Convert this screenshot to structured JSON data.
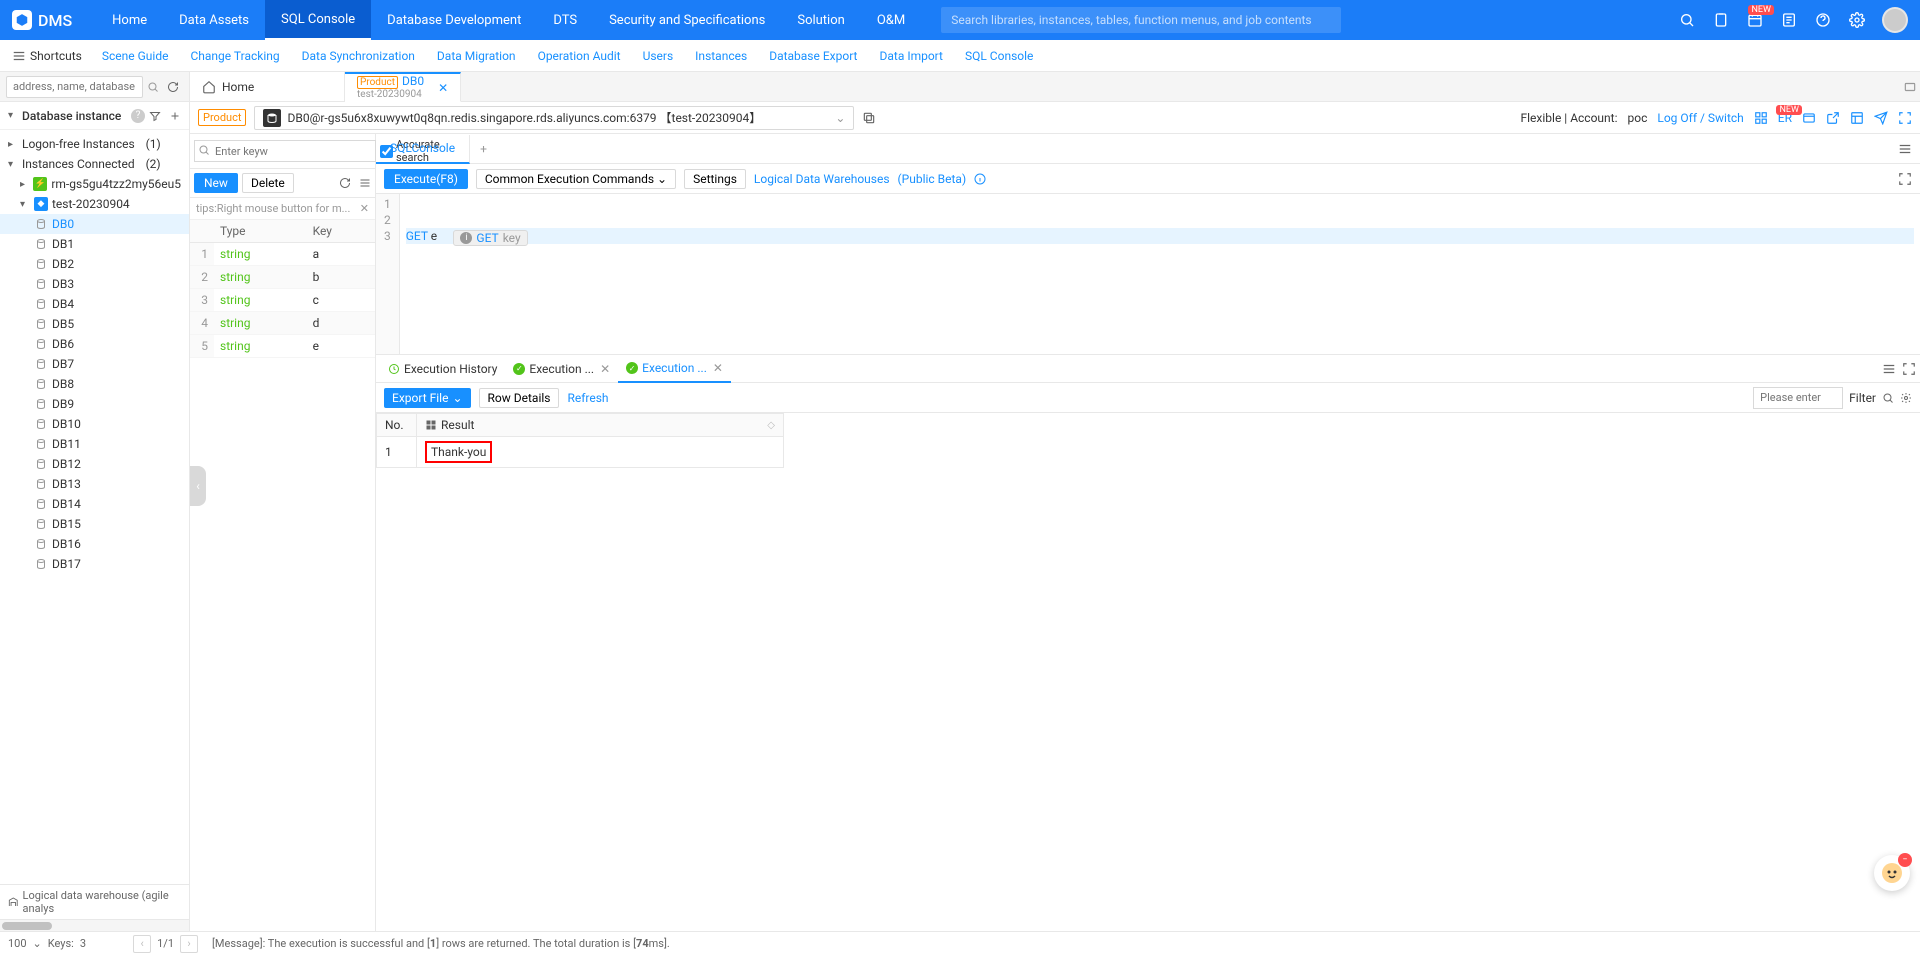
{
  "header": {
    "app_name": "DMS",
    "menu": [
      "Home",
      "Data Assets",
      "SQL Console",
      "Database Development",
      "DTS",
      "Security and Specifications",
      "Solution",
      "O&M"
    ],
    "active_menu_index": 2,
    "search_placeholder": "Search libraries, instances, tables, function menus, and job contents",
    "new_badge": "NEW"
  },
  "subnav": {
    "shortcuts": "Shortcuts",
    "links": [
      "Scene Guide",
      "Change Tracking",
      "Data Synchronization",
      "Data Migration",
      "Operation Audit",
      "Users",
      "Instances",
      "Database Export",
      "Data Import",
      "SQL Console"
    ]
  },
  "tabs": {
    "address_placeholder": "address, name, database name",
    "home_tab": "Home",
    "main_tab": {
      "badge": "Product",
      "title": "DB0",
      "subtitle": "test-20230904"
    }
  },
  "sidebar": {
    "header_title": "Database instance",
    "logon_free": "Logon-free Instances",
    "logon_free_count": "(1)",
    "instances_connected": "Instances Connected",
    "instances_count": "(2)",
    "instance1": "rm-gs5gu4tzz2my56eu5",
    "instance2": "test-20230904",
    "databases": [
      "DB0",
      "DB1",
      "DB2",
      "DB3",
      "DB4",
      "DB5",
      "DB6",
      "DB7",
      "DB8",
      "DB9",
      "DB10",
      "DB11",
      "DB12",
      "DB13",
      "DB14",
      "DB15",
      "DB16",
      "DB17"
    ],
    "footer": "Logical data warehouse (agile analys"
  },
  "connbar": {
    "product_badge": "Product",
    "connection_string": "DB0@r-gs5u6x8xuwywt0q8qn.redis.singapore.rds.aliyuncs.com:6379 【test-20230904】",
    "flexible_label": "Flexible | Account:",
    "account": "poc",
    "logoff": "Log Off / Switch",
    "er_label": "ER",
    "new_badge": "NEW"
  },
  "keypanel": {
    "search_placeholder": "Enter keyw",
    "accurate_label": "Accurate search",
    "btn_new": "New",
    "btn_delete": "Delete",
    "tips": "tips:Right mouse button for m...",
    "columns": {
      "type": "Type",
      "key": "Key"
    },
    "rows": [
      {
        "n": "1",
        "type": "string",
        "key": "a"
      },
      {
        "n": "2",
        "type": "string",
        "key": "b"
      },
      {
        "n": "3",
        "type": "string",
        "key": "c"
      },
      {
        "n": "4",
        "type": "string",
        "key": "d"
      },
      {
        "n": "5",
        "type": "string",
        "key": "e"
      }
    ]
  },
  "editor": {
    "tab_name": "SQLConsole",
    "execute_btn": "Execute(F8)",
    "common_cmds": "Common Execution Commands",
    "settings": "Settings",
    "logical_dw": "Logical Data Warehouses",
    "public_beta": "(Public Beta)",
    "lines": {
      "l1": "1",
      "l2": "2",
      "l3": "3",
      "hint_kw": "GET",
      "hint_param": "key",
      "code3_kw": "GET",
      "code3_rest": " e"
    }
  },
  "results": {
    "tab_history": "Execution History",
    "tab_exec1": "Execution ...",
    "tab_exec2": "Execution ...",
    "export_btn": "Export File",
    "row_details": "Row Details",
    "refresh": "Refresh",
    "filter_placeholder": "Please enter",
    "filter_label": "Filter",
    "col_no": "No.",
    "col_result": "Result",
    "rows": [
      {
        "no": "1",
        "result": "Thank-you"
      }
    ]
  },
  "statusbar": {
    "page_size": "100",
    "keys_label": "Keys:",
    "keys_count": "3",
    "pager": "1/1",
    "message_prefix": "[Message]: The execution is successful and [",
    "message_rows": "1",
    "message_mid": "] rows are returned. The total duration is [",
    "message_ms": "74",
    "message_suffix": "ms]."
  }
}
